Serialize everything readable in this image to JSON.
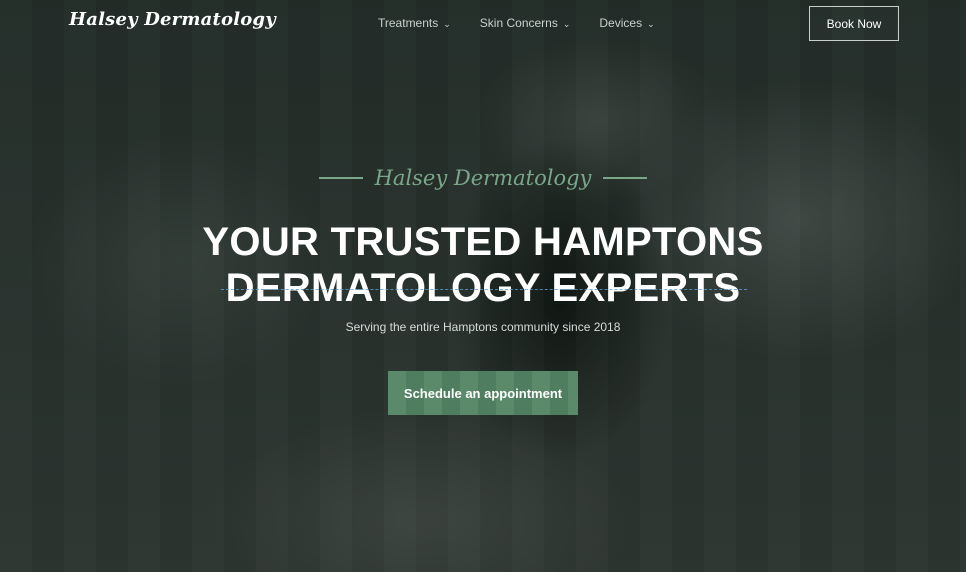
{
  "nav": {
    "logo": "Halsey Dermatology",
    "menu": [
      {
        "label": "Treatments"
      },
      {
        "label": "Skin Concerns"
      },
      {
        "label": "Devices"
      }
    ],
    "book_label": "Book Now"
  },
  "hero": {
    "brand": "Halsey Dermatology",
    "headline_line1": "YOUR TRUSTED HAMPTONS",
    "headline_line2": "DERMATOLOGY EXPERTS",
    "subtitle": "Serving the entire Hamptons community since 2018",
    "cta_label": "Schedule an appointment"
  },
  "colors": {
    "accent": "#7aa78a",
    "cta_background": "#5a8a6a",
    "overlay": "#222b27"
  }
}
